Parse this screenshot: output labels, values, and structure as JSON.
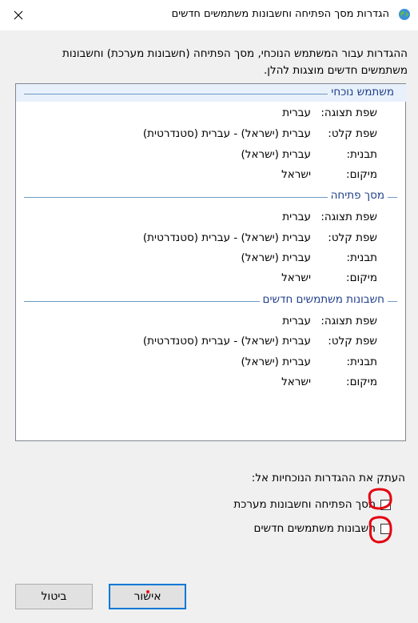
{
  "window": {
    "title": "הגדרות מסך הפתיחה וחשבונות משתמשים חדשים"
  },
  "intro_text": "ההגדרות עבור המשתמש הנוכחי, מסך הפתיחה (חשבונות מערכת) וחשבונות משתמשים חדשים מוצגות להלן.",
  "labels": {
    "display_language": "שפת תצוגה:",
    "input_language": "שפת קלט:",
    "format": "תבנית:",
    "location": "מיקום:"
  },
  "sections": [
    {
      "title": "משתמש נוכחי",
      "display_language": "עברית",
      "input_language": "עברית (ישראל) - עברית (סטנדרטית)",
      "format": "עברית (ישראל)",
      "location": "ישראל"
    },
    {
      "title": "מסך פתיחה",
      "display_language": "עברית",
      "input_language": "עברית (ישראל) - עברית (סטנדרטית)",
      "format": "עברית (ישראל)",
      "location": "ישראל"
    },
    {
      "title": "חשבונות משתמשים חדשים",
      "display_language": "עברית",
      "input_language": "עברית (ישראל) - עברית (סטנדרטית)",
      "format": "עברית (ישראל)",
      "location": "ישראל"
    }
  ],
  "copy_settings": {
    "label": "העתק את ההגדרות הנוכחיות אל:",
    "options": [
      {
        "label": "מסך הפתיחה וחשבונות מערכת",
        "checked": false
      },
      {
        "label": "חשבונות משתמשים חדשים",
        "checked": false
      }
    ]
  },
  "buttons": {
    "ok": "אישור",
    "cancel": "ביטול"
  },
  "annotation_color": "#e3000f"
}
